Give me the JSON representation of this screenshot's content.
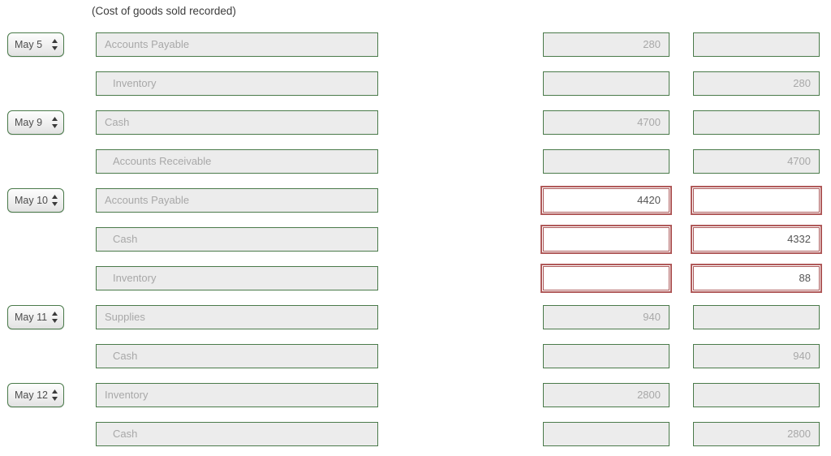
{
  "caption": "(Cost of goods sold recorded)",
  "colors": {
    "field_border": "#4a7a4a",
    "field_fill": "#ececec",
    "placeholder_text": "#a8a8a8",
    "flagged_border": "#b05a5a",
    "flagged_fill": "#ffffff",
    "flagged_text": "#555555",
    "caption_text": "#3c3c3c"
  },
  "icons": {
    "spinner": "updown-spinner-icon"
  },
  "entries": [
    {
      "date": "May 5",
      "has_date": true,
      "account": "Accounts Payable",
      "indent": false,
      "debit": "280",
      "credit": "",
      "flagged": false
    },
    {
      "date": "",
      "has_date": false,
      "account": "Inventory",
      "indent": true,
      "debit": "",
      "credit": "280",
      "flagged": false
    },
    {
      "date": "May 9",
      "has_date": true,
      "account": "Cash",
      "indent": false,
      "debit": "4700",
      "credit": "",
      "flagged": false
    },
    {
      "date": "",
      "has_date": false,
      "account": "Accounts Receivable",
      "indent": true,
      "debit": "",
      "credit": "4700",
      "flagged": false
    },
    {
      "date": "May 10",
      "has_date": true,
      "account": "Accounts Payable",
      "indent": false,
      "debit": "4420",
      "credit": "",
      "flagged": true
    },
    {
      "date": "",
      "has_date": false,
      "account": "Cash",
      "indent": true,
      "debit": "",
      "credit": "4332",
      "flagged": true
    },
    {
      "date": "",
      "has_date": false,
      "account": "Inventory",
      "indent": true,
      "debit": "",
      "credit": "88",
      "flagged": true
    },
    {
      "date": "May 11",
      "has_date": true,
      "account": "Supplies",
      "indent": false,
      "debit": "940",
      "credit": "",
      "flagged": false
    },
    {
      "date": "",
      "has_date": false,
      "account": "Cash",
      "indent": true,
      "debit": "",
      "credit": "940",
      "flagged": false
    },
    {
      "date": "May 12",
      "has_date": true,
      "account": "Inventory",
      "indent": false,
      "debit": "2800",
      "credit": "",
      "flagged": false
    },
    {
      "date": "",
      "has_date": false,
      "account": "Cash",
      "indent": true,
      "debit": "",
      "credit": "2800",
      "flagged": false
    }
  ]
}
